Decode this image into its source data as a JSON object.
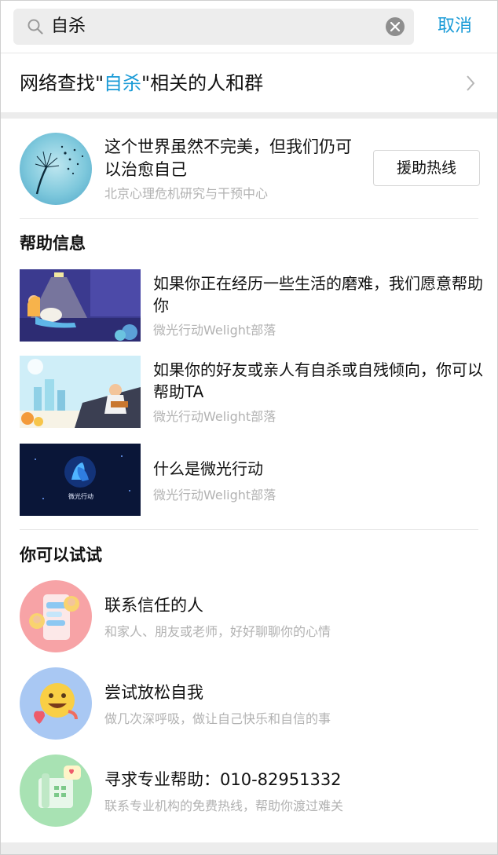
{
  "search": {
    "query": "自杀",
    "cancel_label": "取消"
  },
  "network": {
    "prefix": "网络查找\"",
    "keyword": "自杀",
    "suffix": "\"相关的人和群"
  },
  "hotline": {
    "title": "这个世界虽然不完美，但我们仍可以治愈自己",
    "org": "北京心理危机研究与干预中心",
    "button_label": "援助热线"
  },
  "help_section": {
    "title": "帮助信息",
    "articles": [
      {
        "title": "如果你正在经历一些生活的磨难，我们愿意帮助你",
        "source": "微光行动Welight部落"
      },
      {
        "title": "如果你的好友或亲人有自杀或自残倾向，你可以帮助TA",
        "source": "微光行动Welight部落"
      },
      {
        "title": "什么是微光行动",
        "source": "微光行动Welight部落",
        "thumb_text": "微光行动"
      }
    ]
  },
  "try_section": {
    "title": "你可以试试",
    "tips": [
      {
        "title": "联系信任的人",
        "subtitle": "和家人、朋友或老师，好好聊聊你的心情",
        "icon": "chat-people-icon",
        "color": "#f7a3a6"
      },
      {
        "title": "尝试放松自我",
        "subtitle": "做几次深呼吸，做让自己快乐和自信的事",
        "icon": "smiley-heart-icon",
        "color": "#a9c8f3"
      },
      {
        "title": "寻求专业帮助：010-82951332",
        "subtitle": "联系专业机构的免费热线，帮助你渡过难关",
        "icon": "phone-icon",
        "color": "#a8e2b3"
      }
    ]
  },
  "colors": {
    "accent": "#1a9bd7",
    "muted": "#b2b2b2"
  }
}
